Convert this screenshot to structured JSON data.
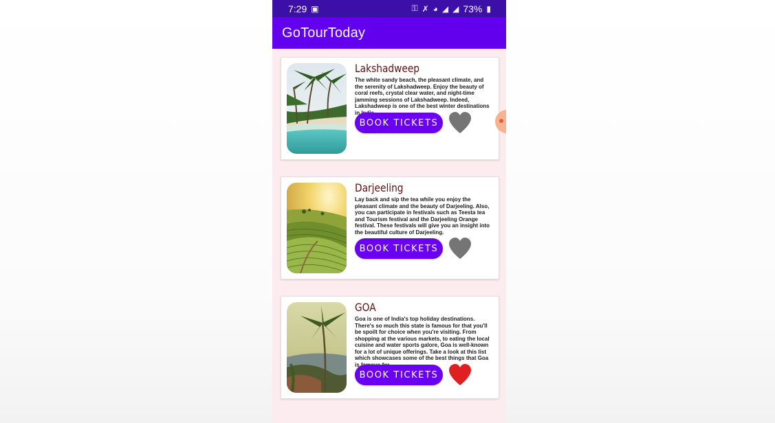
{
  "status_bar": {
    "time": "7:29",
    "battery": "73%",
    "icons": [
      "video-icon",
      "key-icon",
      "mute-icon",
      "wifi-icon",
      "signal-icon",
      "signal-icon",
      "battery-icon"
    ]
  },
  "app_bar": {
    "title": "GoTourToday"
  },
  "colors": {
    "app_bar": "#6200ee",
    "status_bar": "#3b0fa8",
    "button": "#6a00ef",
    "title": "#5c1010",
    "heart_off": "#757575",
    "heart_on": "#e02020"
  },
  "cards": [
    {
      "title": "Lakshadweep",
      "description": "The white sandy beach, the pleasant climate, and the serenity of Lakshadweep.  Enjoy the beauty of coral reefs, crystal clear water, and night-time jamming sessions of Lakshadweep. Indeed, Lakshadweep is one of the best winter destinations in India.",
      "button_label": "BOOK TICKETS",
      "favorite": false
    },
    {
      "title": "Darjeeling",
      "description": "Lay back and sip the tea while you enjoy the pleasant climate and the beauty of Darjeeling. Also, you can participate in festivals such as Teesta tea and Tourism festival and the Darjeeling Orange festival. These festivals will give you an insight into the beautiful culture of Darjeeling.",
      "button_label": "BOOK TICKETS",
      "favorite": false
    },
    {
      "title": "GOA",
      "description": "Goa is one of India's top holiday destinations. There's so much this state is famous for that you'll be spoilt for choice when you're visiting. From shopping at the various markets, to eating the local cuisine and water sports galore, Goa is well-known for a lot of unique offerings. Take a look at this list which showcases some of the best things that Goa is famous for.",
      "button_label": "BOOK TICKETS",
      "favorite": true
    }
  ]
}
